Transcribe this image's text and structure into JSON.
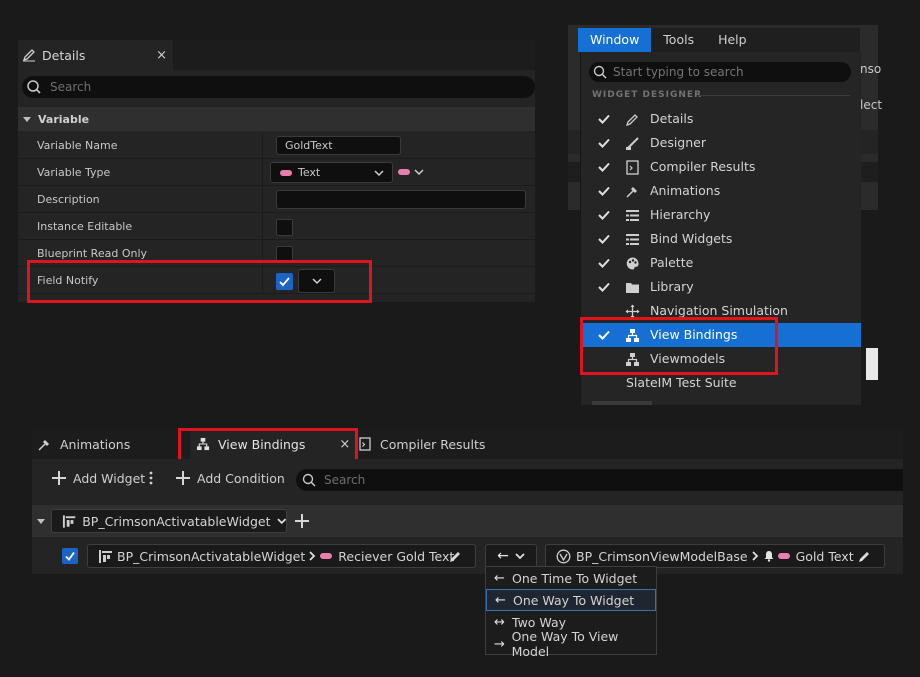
{
  "details": {
    "tab_label": "Details",
    "close_glyph": "×",
    "search_placeholder": "Search",
    "category": "Variable",
    "rows": [
      {
        "label": "Variable Name",
        "value": "GoldText"
      },
      {
        "label": "Variable Type",
        "value": "Text"
      },
      {
        "label": "Description",
        "value": ""
      },
      {
        "label": "Instance Editable",
        "checked": false
      },
      {
        "label": "Blueprint Read Only",
        "checked": false
      },
      {
        "label": "Field Notify",
        "checked": true
      }
    ],
    "type_pill_color": "#e87fb0"
  },
  "menubar": {
    "items": [
      "Window",
      "Tools",
      "Help"
    ],
    "active": "Window"
  },
  "window_menu": {
    "search_placeholder": "Start typing to search",
    "section_label": "WIDGET DESIGNER",
    "items": [
      {
        "label": "Details",
        "checked": true,
        "icon": "pencil-icon"
      },
      {
        "label": "Designer",
        "checked": true,
        "icon": "brush-icon"
      },
      {
        "label": "Compiler Results",
        "checked": true,
        "icon": "compiler-icon"
      },
      {
        "label": "Animations",
        "checked": true,
        "icon": "animation-icon"
      },
      {
        "label": "Hierarchy",
        "checked": true,
        "icon": "hierarchy-icon"
      },
      {
        "label": "Bind Widgets",
        "checked": true,
        "icon": "list-icon"
      },
      {
        "label": "Palette",
        "checked": true,
        "icon": "palette-icon"
      },
      {
        "label": "Library",
        "checked": true,
        "icon": "folder-icon"
      },
      {
        "label": "Navigation Simulation",
        "checked": false,
        "icon": "move-icon"
      },
      {
        "label": "View Bindings",
        "checked": true,
        "icon": "bindings-icon",
        "selected": true
      },
      {
        "label": "Viewmodels",
        "checked": false,
        "icon": "bindings-icon"
      },
      {
        "label": "SlateIM Test Suite",
        "checked": false,
        "icon": ""
      }
    ],
    "peek_text_1": "nso",
    "peek_text_2": "lect"
  },
  "bottom": {
    "tabs": [
      {
        "label": "Animations"
      },
      {
        "label": "View Bindings"
      },
      {
        "label": "Compiler Results"
      }
    ],
    "close_glyph": "×",
    "add_widget": "Add Widget",
    "add_condition": "Add Condition",
    "search_placeholder": "Search",
    "widget_group": "BP_CrimsonActivatableWidget",
    "binding": {
      "enabled": true,
      "source_widget": "BP_CrimsonActivatableWidget",
      "source_property": "Reciever Gold Text",
      "mode_glyph": "←",
      "viewmodel": "BP_CrimsonViewModelBase",
      "viewmodel_property": "Gold Text"
    },
    "dropdown": [
      {
        "glyph": "←",
        "label": "One Time To Widget"
      },
      {
        "glyph": "←",
        "label": "One Way To Widget",
        "highlighted": true
      },
      {
        "glyph": "↔",
        "label": "Two Way"
      },
      {
        "glyph": "→",
        "label": "One Way To View Model"
      }
    ]
  },
  "colors": {
    "accent": "#1670d3",
    "highlight_box": "#e0141e",
    "panel": "#242424",
    "pill": "#e87fb0"
  }
}
